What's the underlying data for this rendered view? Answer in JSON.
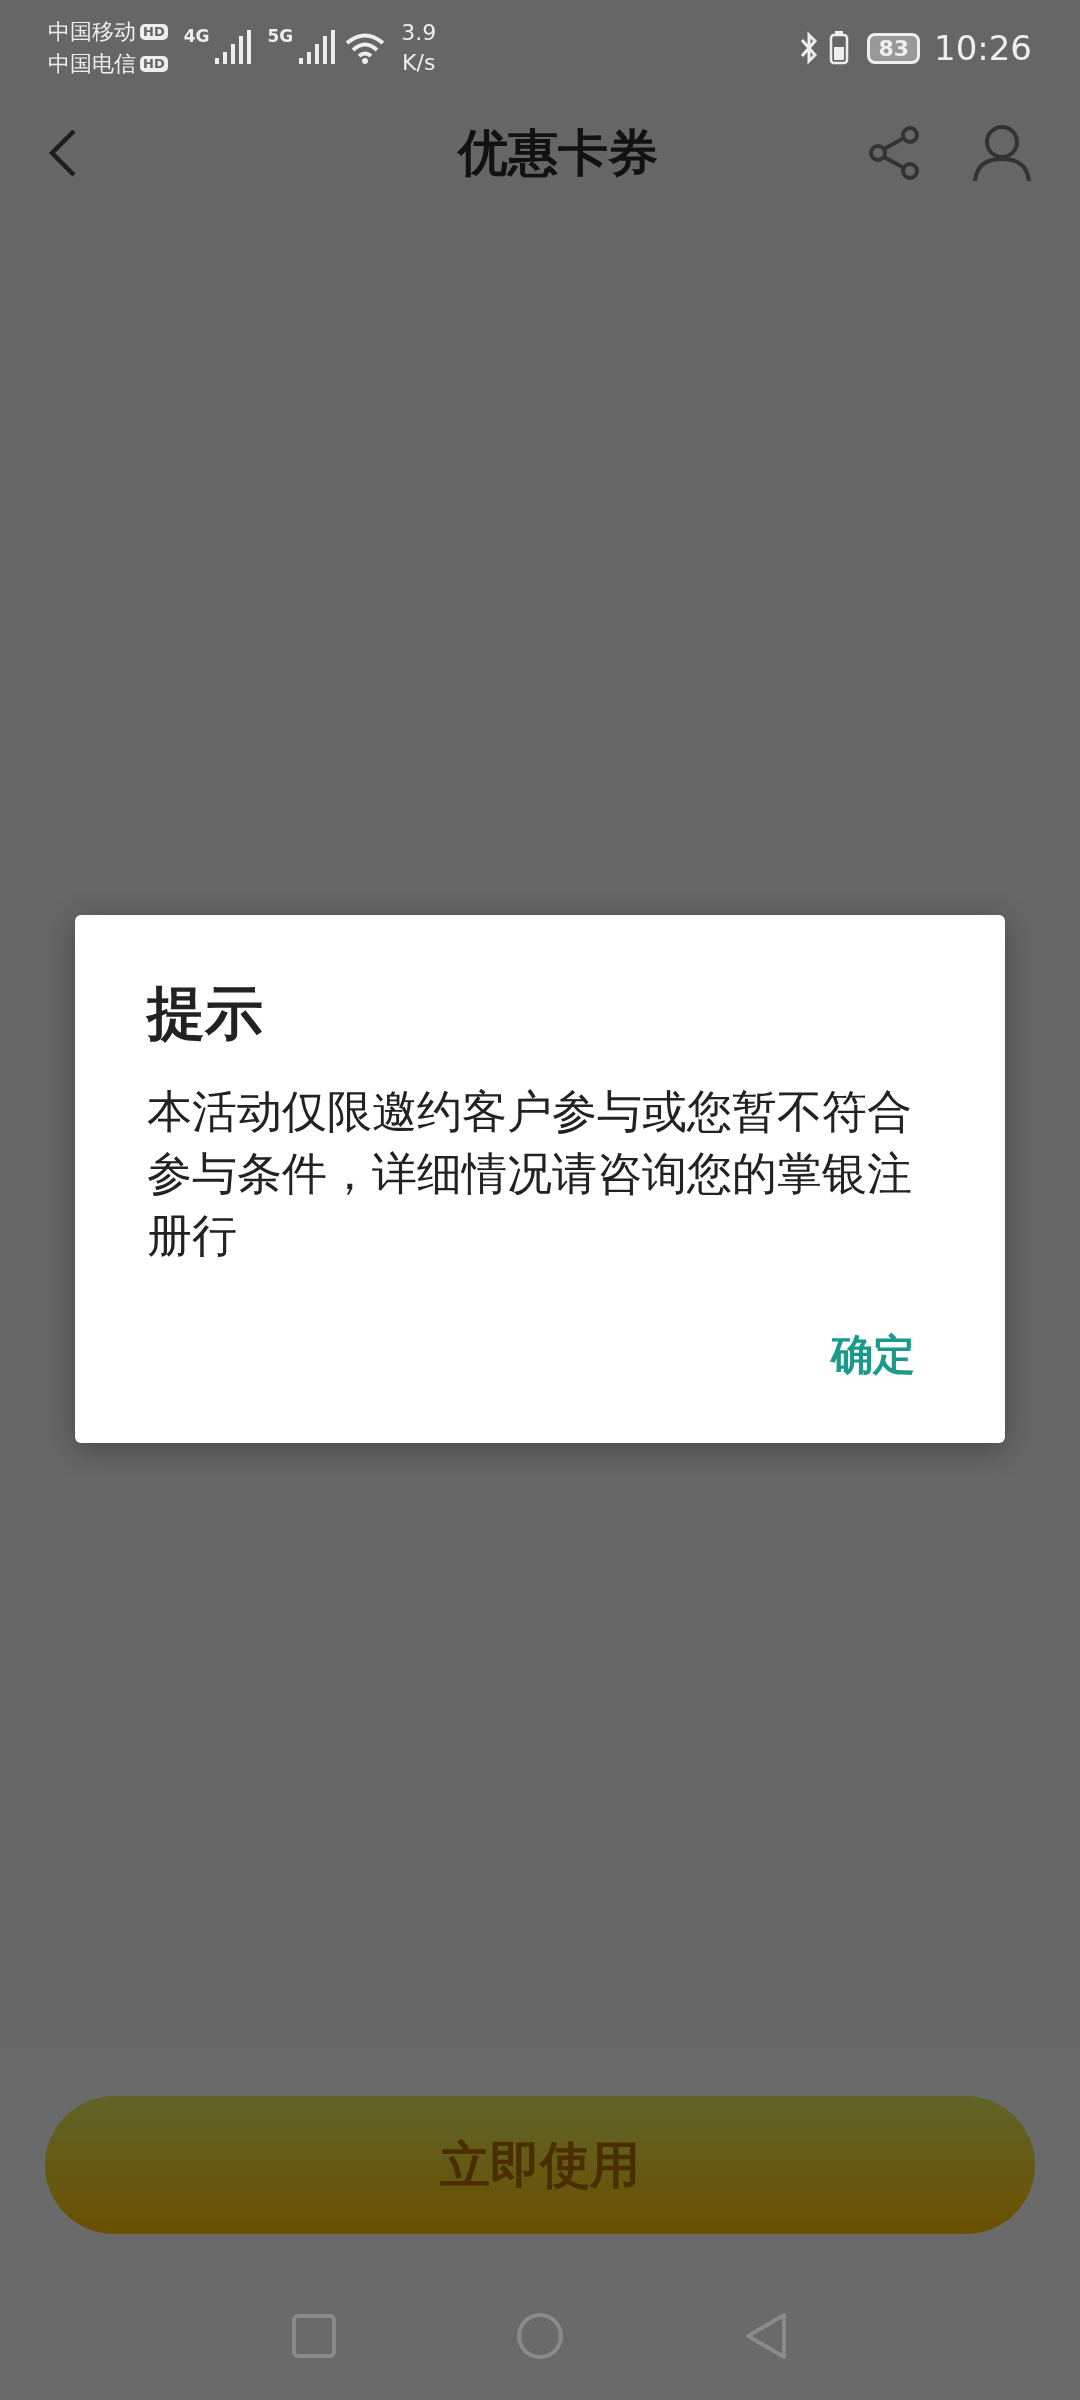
{
  "status_bar": {
    "carriers": [
      {
        "name": "中国移动",
        "badge": "HD",
        "network": "4G"
      },
      {
        "name": "中国电信",
        "badge": "HD",
        "network": "5G"
      }
    ],
    "speed_value": "3.9",
    "speed_unit": "K/s",
    "battery": "83",
    "time": "10:26"
  },
  "header": {
    "title": "优惠卡券"
  },
  "dialog": {
    "title": "提示",
    "message": "本活动仅限邀约客户参与或您暂不符合参与条件，详细情况请咨询您的掌银注册行",
    "confirm": "确定"
  },
  "primary_button": "立即使用"
}
